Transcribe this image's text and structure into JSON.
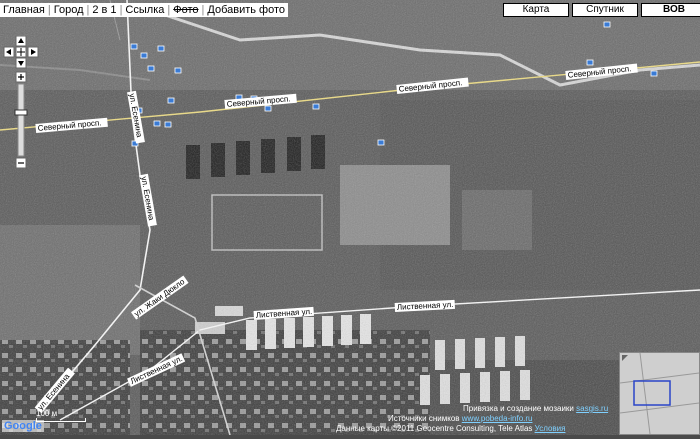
{
  "nav": {
    "items": [
      {
        "label": "Главная",
        "strike": false
      },
      {
        "label": "Город",
        "strike": false
      },
      {
        "label": "2 в 1",
        "strike": false
      },
      {
        "label": "Ссылка",
        "strike": false
      },
      {
        "label": "Фото",
        "strike": true
      },
      {
        "label": "Добавить фото",
        "strike": false
      }
    ]
  },
  "map_types": [
    "Карта",
    "Спутник",
    "ВОВ"
  ],
  "active_map_type": "ВОВ",
  "street_labels": {
    "severny_1": "Северный просп.",
    "severny_2": "Северный просп.",
    "severny_3": "Северный просп.",
    "esenina_1": "ул. Есенина",
    "esenina_2": "ул. Есенина",
    "esenina_3": "ул. Есенина",
    "zhaki_dyuklo": "ул. Жаки Дюкло",
    "listvennaya_1": "Лиственная ул.",
    "listvennaya_2": "Лиственная ул.",
    "listvennaya_3": "Лиственная ул."
  },
  "attribution": {
    "mosaic_prefix": "Привязка и создание мозаики",
    "mosaic_link": "sasgis.ru",
    "images_prefix": "Источники снимков",
    "images_link": "www.pobeda-info.ru",
    "data_prefix": "Данные карты ©2011 Geocentre Consulting, Tele Atlas",
    "data_link": "Условия",
    "scale_label": "100 м"
  },
  "logo_text": "Google",
  "colors": {
    "road": "#e8d98a",
    "marker": "#3a7bd5",
    "label_bg": "#ffffff"
  }
}
